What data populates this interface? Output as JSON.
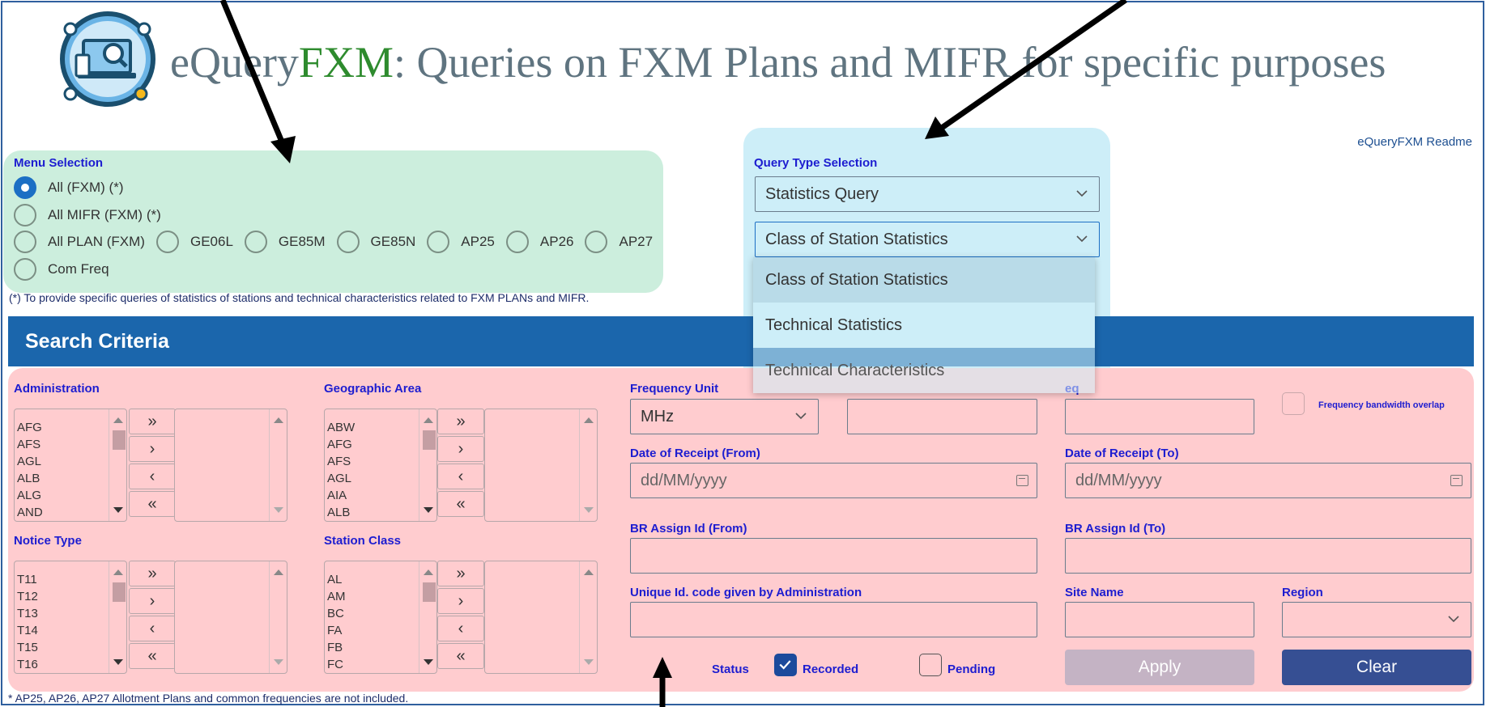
{
  "header": {
    "title_prefix": "eQuery",
    "title_brand": "FXM",
    "title_suffix": ": Queries on FXM Plans and MIFR for specific purposes",
    "readme_link": "eQueryFXM Readme"
  },
  "menu": {
    "label": "Menu Selection",
    "options": {
      "all_fxm": "All (FXM) (*)",
      "all_mifr": "All MIFR (FXM) (*)",
      "all_plan": "All PLAN (FXM)",
      "ge06l": "GE06L",
      "ge85m": "GE85M",
      "ge85n": "GE85N",
      "ap25": "AP25",
      "ap26": "AP26",
      "ap27": "AP27",
      "com_freq": "Com Freq"
    },
    "selected": "all_fxm",
    "note": "(*) To provide specific queries of statistics of stations and technical characteristics related to FXM PLANs and MIFR."
  },
  "query": {
    "label": "Query Type Selection",
    "type_value": "Statistics Query",
    "subtype_value": "Class of Station Statistics",
    "dropdown_options": [
      "Class of Station Statistics",
      "Technical Statistics",
      "Technical Characteristics"
    ]
  },
  "search": {
    "title": "Search Criteria",
    "administration": {
      "label": "Administration",
      "items": [
        "AFG",
        "AFS",
        "AGL",
        "ALB",
        "ALG",
        "AND"
      ]
    },
    "geographic_area": {
      "label": "Geographic Area",
      "items": [
        "ABW",
        "AFG",
        "AFS",
        "AGL",
        "AIA",
        "ALB"
      ]
    },
    "notice_type": {
      "label": "Notice Type",
      "items": [
        "T11",
        "T12",
        "T13",
        "T14",
        "T15",
        "T16"
      ]
    },
    "station_class": {
      "label": "Station Class",
      "items": [
        "AL",
        "AM",
        "BC",
        "FA",
        "FB",
        "FC"
      ]
    },
    "move_buttons": {
      "all_right": "»",
      "right": "›",
      "left": "‹",
      "all_left": "«"
    },
    "frequency_unit": {
      "label": "Frequency Unit",
      "value": "MHz"
    },
    "freq_to_label": "eq",
    "bandwidth_overlap": "Frequency bandwidth overlap",
    "receipt_from": {
      "label": "Date of Receipt (From)",
      "placeholder": "dd/MM/yyyy"
    },
    "receipt_to": {
      "label": "Date of Receipt (To)",
      "placeholder": "dd/MM/yyyy"
    },
    "br_from": {
      "label": "BR Assign Id (From)"
    },
    "br_to": {
      "label": "BR Assign Id (To)"
    },
    "unique_id": {
      "label": "Unique Id. code given by Administration"
    },
    "site_name": {
      "label": "Site Name"
    },
    "region": {
      "label": "Region"
    },
    "status": {
      "label": "Status",
      "recorded": "Recorded",
      "pending": "Pending"
    },
    "apply": "Apply",
    "clear": "Clear"
  },
  "footer_note": "* AP25, AP26, AP27 Allotment Plans and common frequencies are not included.",
  "colors": {
    "brand_green": "#2e8b2e",
    "header_blue": "#1b66ac",
    "label_blue": "#1d1dd0",
    "menu_bg": "#cceedd",
    "query_bg": "#cdeef8",
    "criteria_bg": "#ffcccf",
    "clear_button": "#364f93"
  }
}
